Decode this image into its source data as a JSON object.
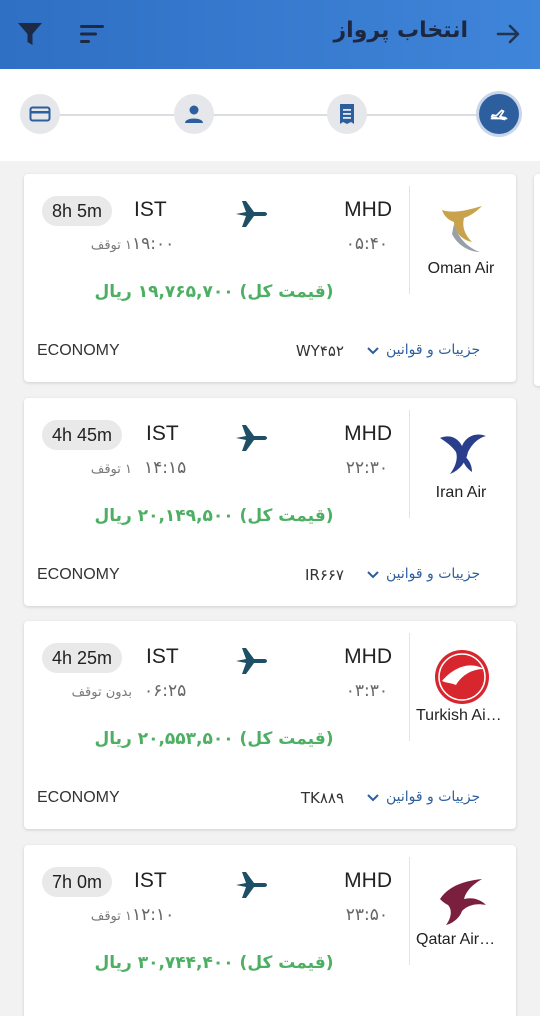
{
  "header": {
    "title": "انتخاب پرواز",
    "back_icon": "arrow-right-icon",
    "filter_icon": "filter-icon",
    "sort_icon": "sort-icon",
    "bg_color": "#3a7bd5"
  },
  "stepper": {
    "steps": [
      {
        "icon": "flight-icon",
        "active": true
      },
      {
        "icon": "receipt-icon",
        "active": false
      },
      {
        "icon": "person-icon",
        "active": false
      },
      {
        "icon": "payment-card-icon",
        "active": false
      }
    ]
  },
  "flights": [
    {
      "airline": "Oman Air",
      "origin": "MHD",
      "destination": "IST",
      "departure": "۰۵:۴۰",
      "arrival": "۱۹:۰۰",
      "duration": "8h 5m",
      "stops": "۱ توقف",
      "price": "(قیمت کل) ۱۹,۷۶۵,۷۰۰ ریال",
      "flight_number": "WY۴۵۲",
      "cabin": "ECONOMY",
      "details_label": "جزییات و قوانین"
    },
    {
      "airline": "Iran Air",
      "origin": "MHD",
      "destination": "IST",
      "departure": "۲۲:۳۰",
      "arrival": "۱۴:۱۵",
      "duration": "4h 45m",
      "stops": "۱ توقف",
      "price": "(قیمت کل) ۲۰,۱۴۹,۵۰۰ ریال",
      "flight_number": "IR۶۶۷",
      "cabin": "ECONOMY",
      "details_label": "جزییات و قوانین"
    },
    {
      "airline": "Turkish Airlines",
      "origin": "MHD",
      "destination": "IST",
      "departure": "۰۳:۳۰",
      "arrival": "۰۶:۲۵",
      "duration": "4h 25m",
      "stops": "بدون توقف",
      "price": "(قیمت کل) ۲۰,۵۵۳,۵۰۰ ریال",
      "flight_number": "TK۸۸۹",
      "cabin": "ECONOMY",
      "details_label": "جزییات و قوانین"
    },
    {
      "airline": "Qatar Airways",
      "origin": "MHD",
      "destination": "IST",
      "departure": "۲۳:۵۰",
      "arrival": "۱۲:۱۰",
      "duration": "7h 0m",
      "stops": "۱ توقف",
      "price": "(قیمت کل) ۳۰,۷۴۴,۴۰۰ ریال",
      "flight_number": "",
      "cabin": "",
      "details_label": ""
    }
  ],
  "colors": {
    "price": "#4caf62",
    "accent": "#2d5f9e"
  }
}
